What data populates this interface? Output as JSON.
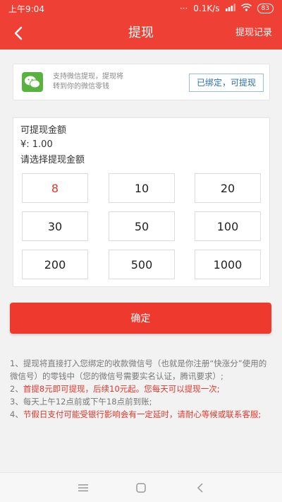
{
  "status_bar": {
    "time": "上午9:04",
    "dots": "···",
    "network_speed": "0.1K/s",
    "battery": "83"
  },
  "header": {
    "title": "提现",
    "right_link": "提现记录"
  },
  "wechat": {
    "line1": "支持微信提现，提现将",
    "line2": "转到你的微信零钱",
    "bound_label": "已绑定，可提现"
  },
  "amount": {
    "available_label": "可提现金额",
    "available_value": "¥: 1.00",
    "select_label": "请选择提现金额",
    "options": [
      "8",
      "10",
      "20",
      "30",
      "50",
      "100",
      "200",
      "500",
      "1000"
    ],
    "selected": "8"
  },
  "confirm_label": "确定",
  "notes": {
    "n1": "1、提现将直接打入您绑定的收款微信号（也就是你注册“快涨分”使用的微信号）的零钱中（您的微信号需要实名认证，腾讯要求）;",
    "n2_prefix": "2、",
    "n2": "首提8元即可提现，后续10元起。您每天可以提现一次;",
    "n3": "3、每天上午12点前或下午18点前到账;",
    "n4_prefix": "4、",
    "n4": "节假日支付可能受银行影响会有一定延时，请耐心等候或联系客服;"
  },
  "colors": {
    "brand_red": "#ee4035",
    "accent_red": "#e2372b",
    "link_blue": "#2f6fb3",
    "wechat_green": "#57b33d"
  },
  "icons": [
    "back-arrow-icon",
    "wechat-icon",
    "wifi-icon",
    "signal-icon",
    "menu-icon",
    "home-icon",
    "back-nav-icon"
  ]
}
